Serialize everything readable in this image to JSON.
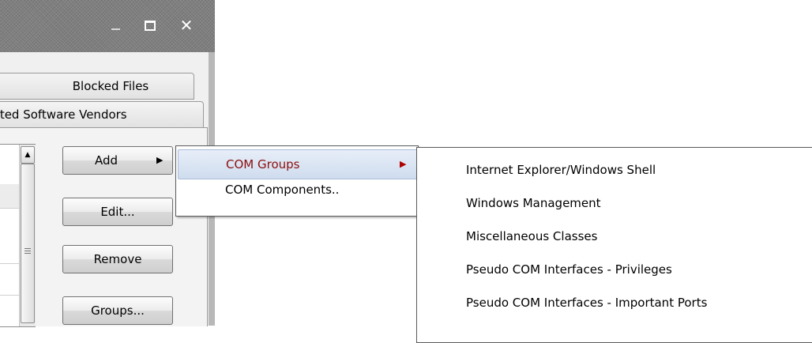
{
  "window": {
    "controls": {
      "minimize_icon": "minimize-icon",
      "maximize_icon": "maximize-icon",
      "close_icon": "close-icon",
      "close_glyph": "✕"
    }
  },
  "tabs": [
    {
      "label": "Blocked Files"
    },
    {
      "label": "sted Software Vendors"
    }
  ],
  "buttons": {
    "add": "Add",
    "edit": "Edit...",
    "remove": "Remove",
    "groups": "Groups..."
  },
  "menu": {
    "items": [
      {
        "label": "COM Groups",
        "has_submenu": true,
        "highlighted": true
      },
      {
        "label": "COM Components..",
        "has_submenu": false
      }
    ],
    "submenu": [
      {
        "label": "Internet Explorer/Windows Shell"
      },
      {
        "label": "Windows Management"
      },
      {
        "label": "Miscellaneous Classes"
      },
      {
        "label": "Pseudo COM Interfaces - Privileges"
      },
      {
        "label": "Pseudo COM Interfaces - Important Ports"
      }
    ]
  },
  "colors": {
    "highlight_text": "#8b0e0e",
    "titlebar": "#7f7f7f"
  }
}
